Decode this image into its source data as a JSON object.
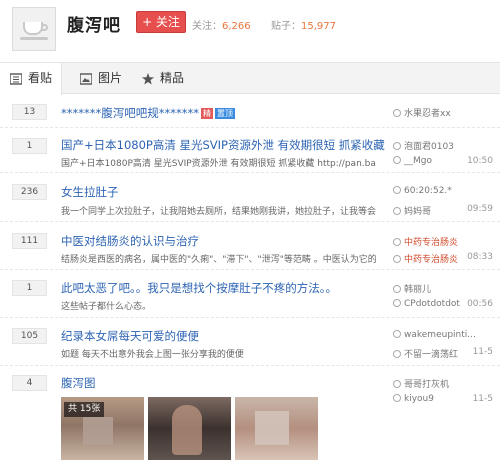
{
  "forum": {
    "name": "腹泻吧",
    "follow_label": "+ 关注",
    "followers_label": "关注：",
    "followers": "6,266",
    "posts_label": "贴子：",
    "posts": "15,977"
  },
  "tabs": [
    {
      "label": "看贴",
      "icon": "list-icon"
    },
    {
      "label": "图片",
      "icon": "image-icon"
    },
    {
      "label": "精品",
      "icon": "star-icon"
    }
  ],
  "threads": [
    {
      "replies": "13",
      "title": "*******腹泻吧吧规*******",
      "badges": [
        "精",
        "置顶"
      ],
      "excerpt": "",
      "author": "水果忍者xx",
      "last_user": "",
      "time": ""
    },
    {
      "replies": "1",
      "title": "国产+日本1080P高清 星光SVIP资源外泄 有效期很短 抓紧收藏",
      "excerpt": "国产+日本1080P高清 星光SVIP资源外泄 有效期很短 抓紧收藏 http://pan.baidu.co...",
      "author": "泡面君0103",
      "last_user": "__Mgo",
      "time": "10:50"
    },
    {
      "replies": "236",
      "title": "女生拉肚子",
      "excerpt": "我一个同学上次拉肚子，让我陪她去厕所，结果她刚我讲，她拉肚子，让我等会，...",
      "author": "60:20:52.*",
      "last_user": "妈妈哥",
      "time": "09:59"
    },
    {
      "replies": "111",
      "title": "中医对结肠炎的认识与治疗",
      "excerpt": "结肠炎是西医的病名，属中医的\"久痢\"、\"滞下\"、\"泄泻\"等范畴 。中医认为它的基本...",
      "author": "中药专治肠炎",
      "last_user": "中药专治肠炎",
      "time": "08:33"
    },
    {
      "replies": "1",
      "title": "此吧太恶了吧。。我只是想找个按摩肚子不疼的方法。。",
      "excerpt": "这些帖子都什么心态。",
      "author": "韩丽儿",
      "last_user": "CPdotdotdot",
      "time": "00:56"
    },
    {
      "replies": "105",
      "title": "纪录本女屌每天可爱的便便",
      "excerpt": "如题 每天不出意外我会上图一张分享我的便便",
      "author": "wakemeupinti...",
      "last_user": "不留一滴荡红",
      "time": "11-5"
    },
    {
      "replies": "4",
      "title": "腹泻图",
      "excerpt": "",
      "author": "哥哥打灰机",
      "last_user": "kiyou9",
      "time": "11-5",
      "pic_count": "共 15张"
    }
  ]
}
